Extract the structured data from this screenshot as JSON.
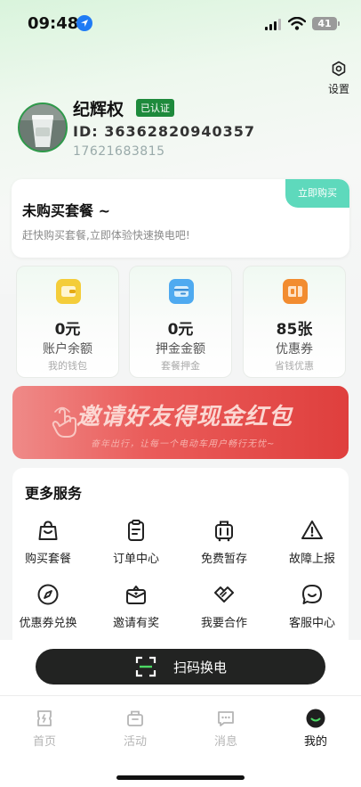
{
  "status_bar": {
    "time": "09:48",
    "battery": "41"
  },
  "settings": {
    "label": "设置",
    "icon": "gear-icon"
  },
  "profile": {
    "name": "纪辉权",
    "badge": "已认证",
    "id_text": "ID: 36362820940357",
    "phone": "17621683815"
  },
  "package": {
    "title": "未购买套餐 ~",
    "desc": "赶快购买套餐,立即体验快速换电吧!",
    "buy_label": "立即购买"
  },
  "stats": [
    {
      "value": "0元",
      "name": "账户余额",
      "sub": "我的钱包",
      "icon": "wallet-icon",
      "color": "#f3c323"
    },
    {
      "value": "0元",
      "name": "押金金额",
      "sub": "套餐押金",
      "icon": "card-icon",
      "color": "#47a6e8"
    },
    {
      "value": "85张",
      "name": "优惠券",
      "sub": "省钱优惠",
      "icon": "coupon-icon",
      "color": "#f08a2e"
    }
  ],
  "banner": {
    "title": "邀请好友得现金红包",
    "sub": "奋年出行，让每一个电动车用户畅行无忧~"
  },
  "services": {
    "title": "更多服务",
    "items": [
      {
        "label": "购买套餐",
        "icon": "shopping-bag-icon"
      },
      {
        "label": "订单中心",
        "icon": "clipboard-icon"
      },
      {
        "label": "免费暂存",
        "icon": "luggage-icon"
      },
      {
        "label": "故障上报",
        "icon": "warning-icon"
      },
      {
        "label": "优惠券兑换",
        "icon": "compass-icon"
      },
      {
        "label": "邀请有奖",
        "icon": "gift-icon"
      },
      {
        "label": "我要合作",
        "icon": "handshake-icon"
      },
      {
        "label": "客服中心",
        "icon": "chat-bubble-icon"
      }
    ]
  },
  "scan": {
    "label": "扫码换电"
  },
  "tabs": [
    {
      "label": "首页",
      "active": false
    },
    {
      "label": "活动",
      "active": false
    },
    {
      "label": "消息",
      "active": false
    },
    {
      "label": "我的",
      "active": true
    }
  ]
}
